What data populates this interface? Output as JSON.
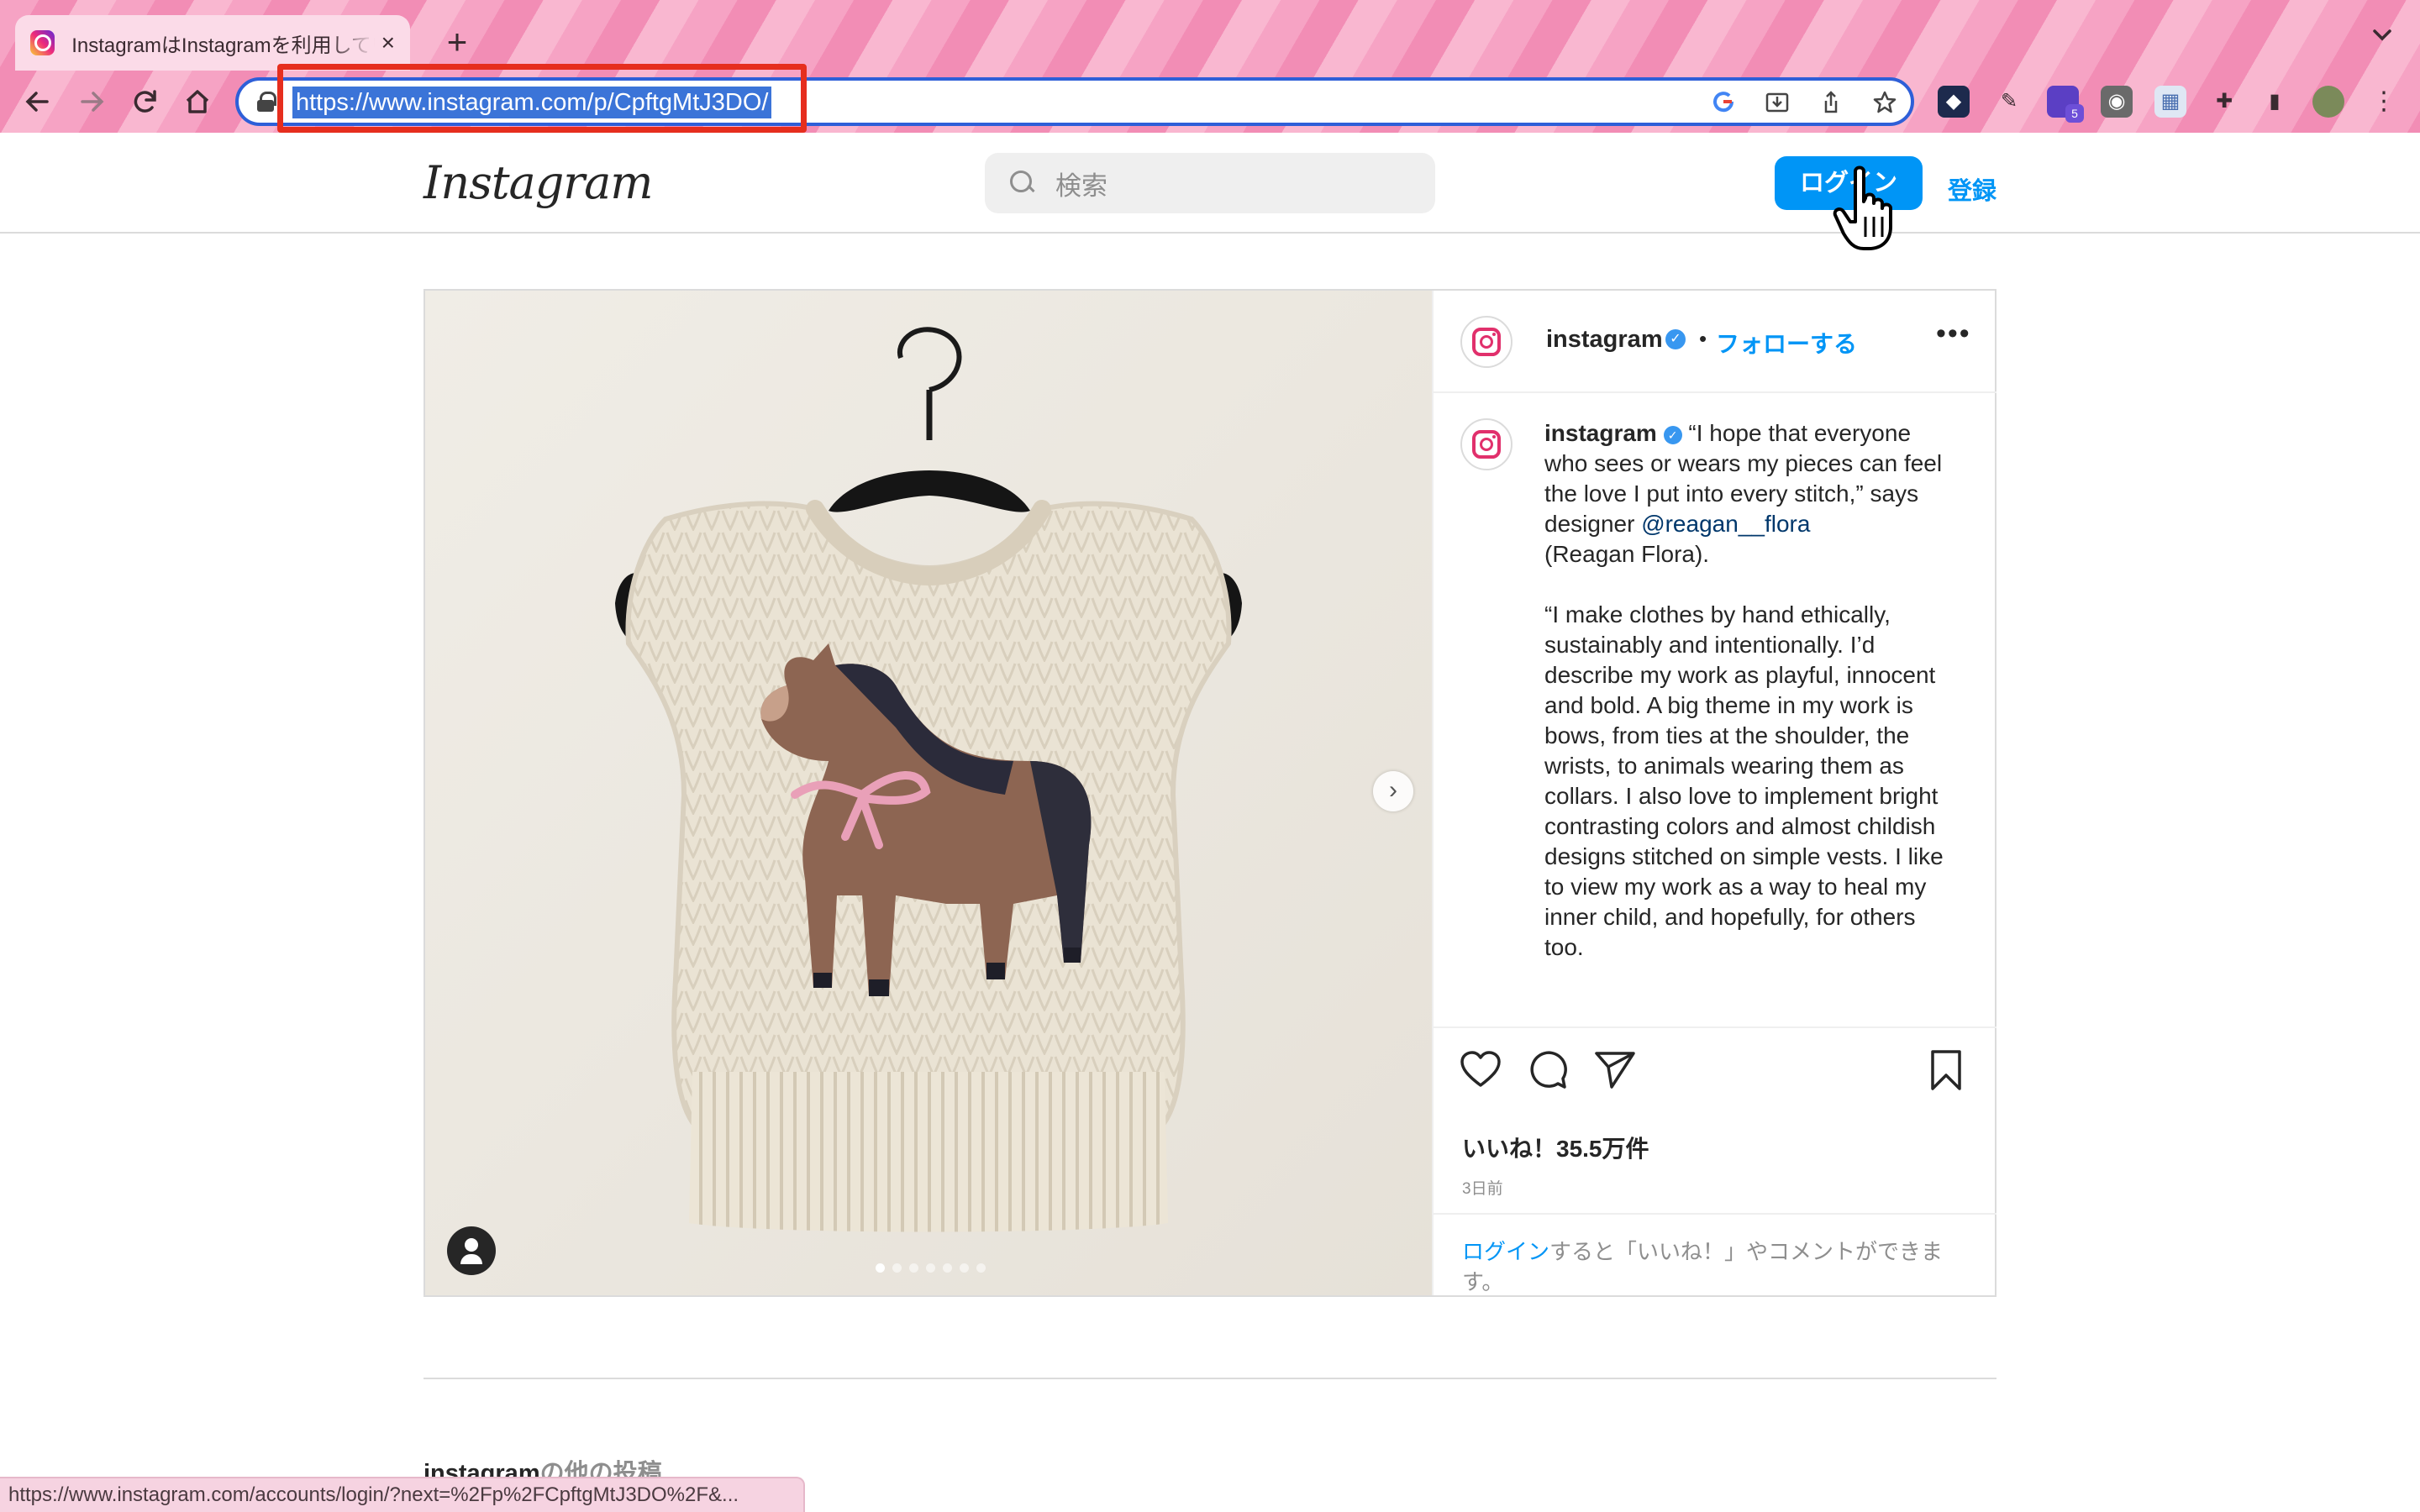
{
  "browser": {
    "tab_title": "InstagramはInstagramを利用しています",
    "tab_close": "×",
    "new_tab": "+",
    "url": "https://www.instagram.com/p/CpftgMtJ3DO/",
    "status_url": "https://www.instagram.com/accounts/login/?next=%2Fp%2FCpftgMtJ3DO%2F&...",
    "extension_badge": "5"
  },
  "header": {
    "logo": "Instagram",
    "search_placeholder": "検索",
    "login_label": "ログイン",
    "signup_label": "登録"
  },
  "post": {
    "username": "instagram",
    "verified": "✓",
    "dot": "•",
    "follow_label": "フォローする",
    "more": "•••",
    "caption_user": "instagram",
    "caption_part1": "“I hope that everyone who sees or wears my pieces can feel the love I put into every stitch,” says designer ",
    "caption_mention": "@reagan__flora",
    "caption_part2": "\n(Reagan Flora).\n\n“I make clothes by hand ethically, sustainably and intentionally. I’d describe my work as playful, innocent and bold. A big theme in my work is bows, from ties at the shoulder, the wrists, to animals wearing them as collars. I also love to implement bright contrasting colors and almost childish designs stitched on simple vests. I like to view my work as a way to heal my inner child, and hopefully, for others too.",
    "likes": "いいね！35.5万件",
    "timestamp": "3日前",
    "login_link": "ログイン",
    "login_prompt_rest": "すると「いいね！」やコメントができます。",
    "carousel_count": 7,
    "carousel_active": 1,
    "next_arrow": "›"
  },
  "footer": {
    "more_posts_user": "instagram",
    "more_posts_rest": "の他の投稿"
  },
  "colors": {
    "accent": "#0095f6",
    "url_highlight": "#e62e1e",
    "chrome_pink": "#f28db5"
  },
  "icons": [
    "back-icon",
    "forward-icon",
    "reload-icon",
    "home-icon",
    "lock-icon",
    "google-icon",
    "install-icon",
    "share-icon",
    "star-icon",
    "heart-icon",
    "comment-icon",
    "send-icon",
    "bookmark-icon",
    "search-icon",
    "more-icon",
    "verified-icon"
  ]
}
